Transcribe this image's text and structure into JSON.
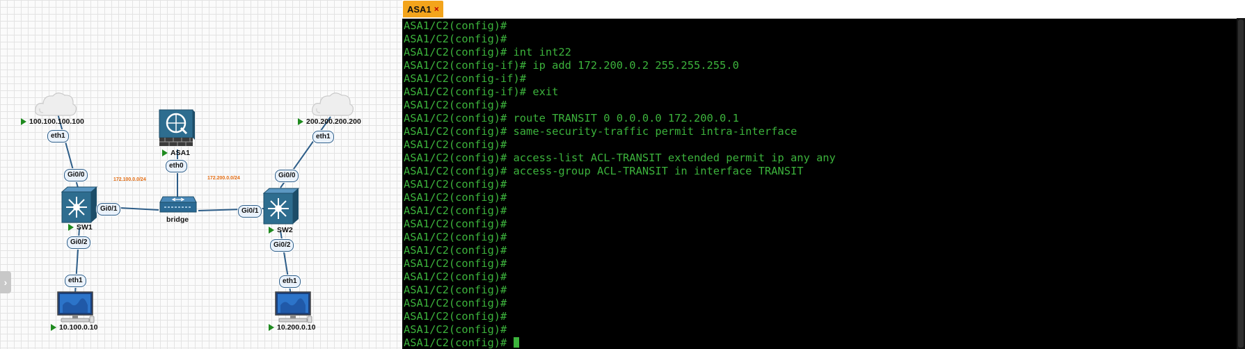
{
  "canvas": {
    "nodes": {
      "cloud1": "100.100.100.100",
      "cloud2": "200.200.200.200",
      "asa1": "ASA1",
      "bridge": "bridge",
      "sw1": "SW1",
      "sw2": "SW2",
      "pc1": "10.100.0.10",
      "pc2": "10.200.0.10"
    },
    "interfaces": {
      "cloud1_eth1": "eth1",
      "sw1_gi00": "Gi0/0",
      "sw1_gi01": "Gi0/1",
      "sw1_gi02": "Gi0/2",
      "pc1_eth1": "eth1",
      "asa1_eth0": "eth0",
      "cloud2_eth1": "eth1",
      "sw2_gi00": "Gi0/0",
      "sw2_gi01": "Gi0/1",
      "sw2_gi02": "Gi0/2",
      "pc2_eth1": "eth1"
    },
    "subnets": {
      "left": "172.100.0.0/24",
      "right": "172.200.0.0/24"
    },
    "collapse_icon": "chevron-right-icon"
  },
  "terminal": {
    "tab_label": "ASA1",
    "tab_close": "×",
    "lines": [
      "ASA1/C2(config)#",
      "ASA1/C2(config)#",
      "ASA1/C2(config)# int int22",
      "ASA1/C2(config-if)# ip add 172.200.0.2 255.255.255.0",
      "ASA1/C2(config-if)#",
      "ASA1/C2(config-if)# exit",
      "ASA1/C2(config)#",
      "ASA1/C2(config)# route TRANSIT 0 0.0.0.0 172.200.0.1",
      "ASA1/C2(config)# same-security-traffic permit intra-interface",
      "ASA1/C2(config)#",
      "ASA1/C2(config)# access-list ACL-TRANSIT extended permit ip any any",
      "ASA1/C2(config)# access-group ACL-TRANSIT in interface TRANSIT",
      "ASA1/C2(config)#",
      "ASA1/C2(config)#",
      "ASA1/C2(config)#",
      "ASA1/C2(config)#",
      "ASA1/C2(config)#",
      "ASA1/C2(config)#",
      "ASA1/C2(config)#",
      "ASA1/C2(config)#",
      "ASA1/C2(config)#",
      "ASA1/C2(config)#",
      "ASA1/C2(config)#",
      "ASA1/C2(config)#",
      "ASA1/C2(config)# "
    ],
    "colors": {
      "text": "#3cb33c",
      "background": "#000000",
      "tab": "#f3a41c"
    }
  }
}
